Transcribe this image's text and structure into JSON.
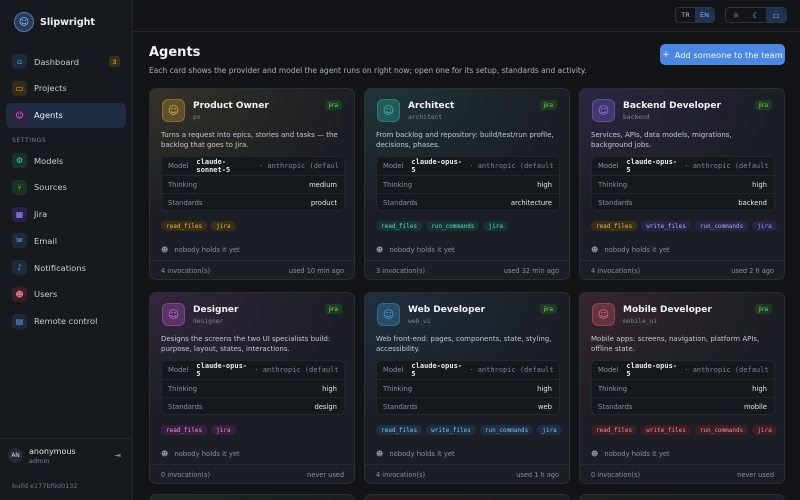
{
  "brand": {
    "name": "Slipwright",
    "logo_icon": "robot-logo-icon"
  },
  "nav": {
    "items": [
      {
        "id": "dashboard",
        "label": "Dashboard",
        "icon": "home-icon",
        "glyph": "⌂",
        "color": "#5aa0e6",
        "bg": "#1d2a38",
        "badge": "3"
      },
      {
        "id": "projects",
        "label": "Projects",
        "icon": "folder-icon",
        "glyph": "▭",
        "color": "#e0a94a",
        "bg": "#352b18"
      },
      {
        "id": "agents",
        "label": "Agents",
        "icon": "robot-icon",
        "glyph": "☺",
        "color": "#d37fd6",
        "bg": "#3a2040",
        "active": true
      }
    ],
    "settings_label": "SETTINGS",
    "settings_items": [
      {
        "id": "models",
        "label": "Models",
        "icon": "cpu-icon",
        "glyph": "⚙",
        "color": "#4fc9b0",
        "bg": "#173430"
      },
      {
        "id": "sources",
        "label": "Sources",
        "icon": "branch-icon",
        "glyph": "⑂",
        "color": "#63c46c",
        "bg": "#1a3320"
      },
      {
        "id": "jira",
        "label": "Jira",
        "icon": "kanban-icon",
        "glyph": "▦",
        "color": "#9a8ef0",
        "bg": "#27234a"
      },
      {
        "id": "email",
        "label": "Email",
        "icon": "mail-icon",
        "glyph": "✉",
        "color": "#5aa0e6",
        "bg": "#1d2a38"
      },
      {
        "id": "notifications",
        "label": "Notifications",
        "icon": "bell-icon",
        "glyph": "♪",
        "color": "#5aa0e6",
        "bg": "#1d2a38"
      },
      {
        "id": "users",
        "label": "Users",
        "icon": "users-icon",
        "glyph": "☻",
        "color": "#e07a86",
        "bg": "#3a1f25"
      },
      {
        "id": "remote",
        "label": "Remote control",
        "icon": "chat-icon",
        "glyph": "▤",
        "color": "#5aa0e6",
        "bg": "#1d2a38"
      }
    ]
  },
  "user": {
    "initials": "AN",
    "name": "anonymous",
    "role": "admin"
  },
  "build": "build e177bf9d0132",
  "topbar": {
    "languages": [
      "TR",
      "EN"
    ],
    "active_language": "EN",
    "theme_icons": [
      "sun-icon",
      "moon-icon",
      "monitor-icon"
    ],
    "theme_glyphs": [
      "☼",
      "☾",
      "▭"
    ]
  },
  "page": {
    "title": "Agents",
    "subtitle": "Each card shows the provider and model the agent runs on right now; open one for its setup, standards and activity.",
    "add_button": "Add someone to the team"
  },
  "labels": {
    "model": "Model",
    "thinking": "Thinking",
    "standards": "Standards",
    "holder": "nobody holds it yet"
  },
  "agents": [
    {
      "name": "Product Owner",
      "code": "po",
      "jira": "jira",
      "icon": "product-owner-avatar-icon",
      "accent": "#d9b24a",
      "glow": "rgba(190,150,50,0.16)",
      "desc": "Turns a request into epics, stories and tasks — the backlog that goes to Jira.",
      "model": "claude-sonnet-5",
      "provider": "· anthropic (default)",
      "thinking": "medium",
      "standards": "product",
      "perms": [
        "read_files",
        "jira"
      ],
      "invocations": "4 invocation(s)",
      "used": "used 10 min ago"
    },
    {
      "name": "Architect",
      "code": "architect",
      "jira": "jira",
      "icon": "architect-avatar-icon",
      "accent": "#3fbfb6",
      "glow": "rgba(50,170,160,0.16)",
      "desc": "From backlog and repository: build/test/run profile, decisions, phases.",
      "model": "claude-opus-5",
      "provider": "· anthropic (default)",
      "thinking": "high",
      "standards": "architecture",
      "perms": [
        "read_files",
        "run_commands",
        "jira"
      ],
      "invocations": "3 invocation(s)",
      "used": "used 32 min ago"
    },
    {
      "name": "Backend Developer",
      "code": "backend",
      "jira": "jira",
      "icon": "backend-avatar-icon",
      "accent": "#9a7ff0",
      "glow": "rgba(120,90,210,0.16)",
      "desc": "Services, APIs, data models, migrations, background jobs.",
      "model": "claude-opus-5",
      "provider": "· anthropic (default)",
      "thinking": "high",
      "standards": "backend",
      "perms": [
        "read_files",
        "write_files",
        "run_commands",
        "jira"
      ],
      "invocations": "4 invocation(s)",
      "used": "used 2 h ago"
    },
    {
      "name": "Designer",
      "code": "designer",
      "jira": "jira",
      "icon": "designer-avatar-icon",
      "accent": "#c772d8",
      "glow": "rgba(170,80,190,0.16)",
      "desc": "Designs the screens the two UI specialists build: purpose, layout, states, interactions.",
      "model": "claude-opus-5",
      "provider": "· anthropic (default)",
      "thinking": "high",
      "standards": "design",
      "perms": [
        "read_files",
        "jira"
      ],
      "invocations": "0 invocation(s)",
      "used": "never used"
    },
    {
      "name": "Web Developer",
      "code": "web_ui",
      "jira": "jira",
      "icon": "web-dev-avatar-icon",
      "accent": "#4ea3d8",
      "glow": "rgba(60,140,200,0.16)",
      "desc": "Web front-end: pages, components, state, styling, accessibility.",
      "model": "claude-opus-5",
      "provider": "· anthropic (default)",
      "thinking": "high",
      "standards": "web",
      "perms": [
        "read_files",
        "write_files",
        "run_commands",
        "jira"
      ],
      "invocations": "4 invocation(s)",
      "used": "used 1 h ago"
    },
    {
      "name": "Mobile Developer",
      "code": "mobile_ui",
      "jira": "jira",
      "icon": "mobile-dev-avatar-icon",
      "accent": "#e0707e",
      "glow": "rgba(200,80,100,0.16)",
      "desc": "Mobile apps: screens, navigation, platform APIs, offline state.",
      "model": "claude-opus-5",
      "provider": "· anthropic (default)",
      "thinking": "high",
      "standards": "mobile",
      "perms": [
        "read_files",
        "write_files",
        "run_commands",
        "jira"
      ],
      "invocations": "0 invocation(s)",
      "used": "never used"
    }
  ]
}
